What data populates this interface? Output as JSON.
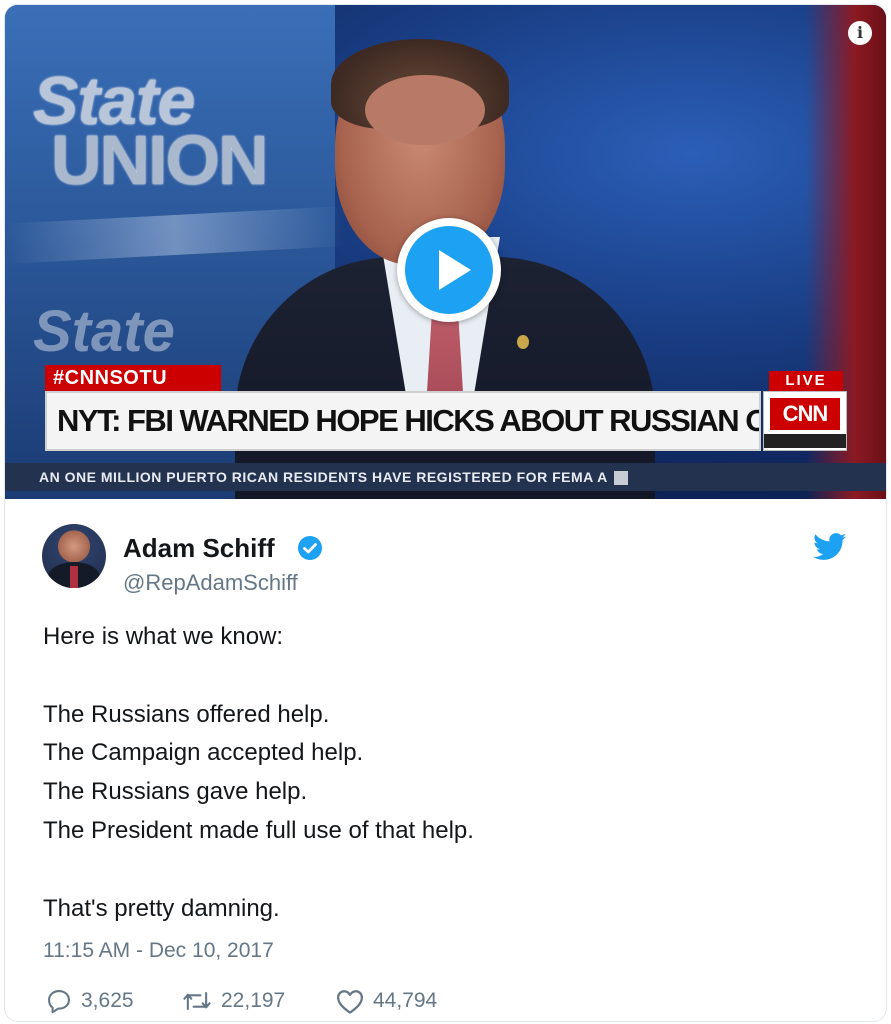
{
  "video": {
    "logo_line1": "State",
    "logo_line2": "UNION",
    "logo_line3": "State",
    "hashtag": "#CNNSOTU",
    "live": "LIVE",
    "headline": "NYT: FBI WARNED HOPE HICKS ABOUT RUSSIAN OUTREACH",
    "network": "CNN",
    "ticker": "AN ONE MILLION PUERTO RICAN RESIDENTS HAVE REGISTERED FOR FEMA A",
    "info_icon": "info-icon",
    "play_icon": "play-icon"
  },
  "tweet": {
    "author_name": "Adam Schiff",
    "handle": "@RepAdamSchiff",
    "verified_icon": "verified-badge-icon",
    "brand_icon": "twitter-bird-icon",
    "lines": [
      "Here is what we know:",
      "The Russians offered help.",
      "The Campaign accepted help.",
      "The Russians gave help.",
      "The President made full use of that help.",
      "That's pretty damning."
    ],
    "timestamp": "11:15 AM - Dec 10, 2017",
    "replies": "3,625",
    "retweets": "22,197",
    "likes": "44,794"
  },
  "colors": {
    "twitter_blue": "#1da1f2",
    "cnn_red": "#cc0000",
    "text": "#14171a",
    "muted": "#657786"
  }
}
